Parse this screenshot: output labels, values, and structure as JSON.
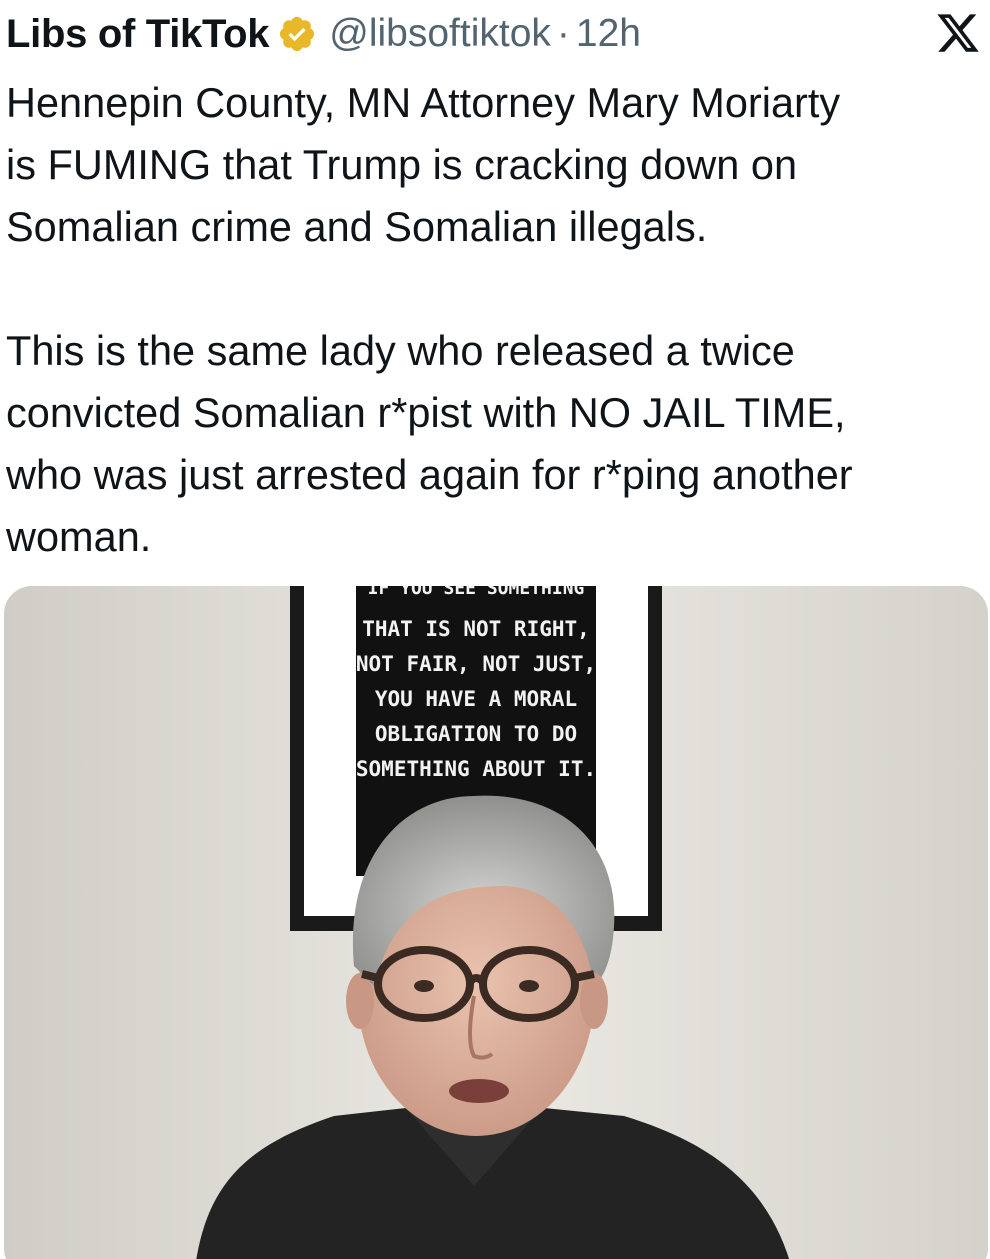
{
  "tweet": {
    "display_name": "Libs of TikTok",
    "handle": "@libsoftiktok",
    "separator": "·",
    "time": "12h",
    "text": "Hennepin County, MN Attorney Mary Moriarty\nis FUMING that Trump is cracking down on\nSomalian crime and Somalian illegals.\n\nThis is the same lady who released a twice\nconvicted Somalian r*pist with NO JAIL TIME,\nwho was just arrested again for r*ping another\nwoman."
  },
  "icons": {
    "verified": "verified-badge-icon",
    "platform": "x-logo-icon"
  },
  "media": {
    "poster_lines": [
      "IF YOU SEE SOMETHING",
      "THAT IS NOT RIGHT,",
      "NOT FAIR, NOT JUST,",
      "YOU HAVE A MORAL",
      "OBLIGATION TO DO",
      "SOMETHING ABOUT IT."
    ]
  },
  "colors": {
    "text": "#0f1419",
    "secondary": "#536471",
    "verified_gold": "#e8b829"
  }
}
